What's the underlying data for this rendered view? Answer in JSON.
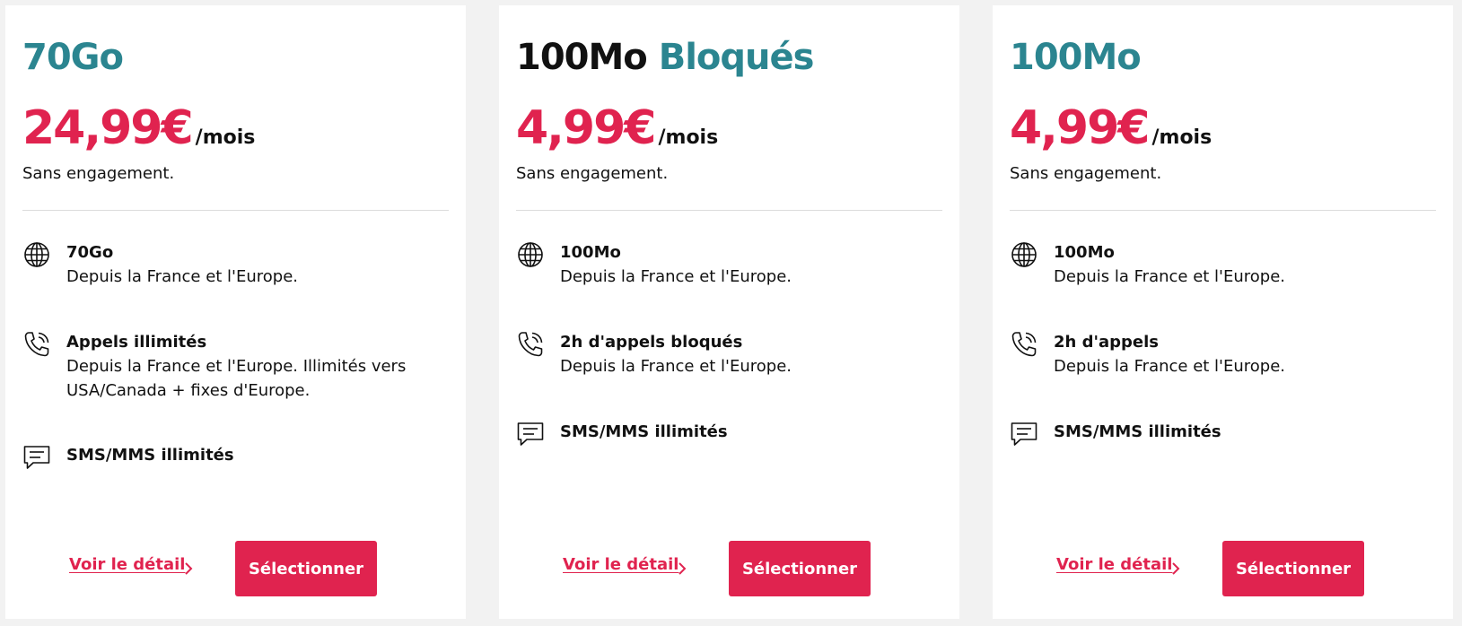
{
  "colors": {
    "accent": "#e0234f",
    "teal": "#2b8590",
    "text": "#111111",
    "background": "#f2f2f2",
    "card": "#ffffff"
  },
  "offers": [
    {
      "title_dark": "",
      "title_teal": "70Go",
      "price": "24,99€",
      "period": "/mois",
      "commitment": "Sans engagement.",
      "features": [
        {
          "icon": "globe-icon",
          "title": "70Go",
          "desc": "Depuis la France et l'Europe."
        },
        {
          "icon": "phone-icon",
          "title": "Appels illimités",
          "desc": "Depuis la France et l'Europe. Illimités vers USA/Canada + fixes d'Europe."
        },
        {
          "icon": "message-icon",
          "title": "SMS/MMS illimités",
          "desc": ""
        }
      ],
      "detail_link": "Voir le détail",
      "select_label": "Sélectionner"
    },
    {
      "title_dark": "100Mo",
      "title_teal": "Bloqués",
      "price": "4,99€",
      "period": "/mois",
      "commitment": "Sans engagement.",
      "features": [
        {
          "icon": "globe-icon",
          "title": "100Mo",
          "desc": "Depuis la France et l'Europe."
        },
        {
          "icon": "phone-icon",
          "title": "2h d'appels bloqués",
          "desc": "Depuis la France et l'Europe."
        },
        {
          "icon": "message-icon",
          "title": "SMS/MMS illimités",
          "desc": ""
        }
      ],
      "detail_link": "Voir le détail",
      "select_label": "Sélectionner"
    },
    {
      "title_dark": "",
      "title_teal": "100Mo",
      "price": "4,99€",
      "period": "/mois",
      "commitment": "Sans engagement.",
      "features": [
        {
          "icon": "globe-icon",
          "title": "100Mo",
          "desc": "Depuis la France et l'Europe."
        },
        {
          "icon": "phone-icon",
          "title": "2h d'appels",
          "desc": "Depuis la France et l'Europe."
        },
        {
          "icon": "message-icon",
          "title": "SMS/MMS illimités",
          "desc": ""
        }
      ],
      "detail_link": "Voir le détail",
      "select_label": "Sélectionner"
    }
  ]
}
